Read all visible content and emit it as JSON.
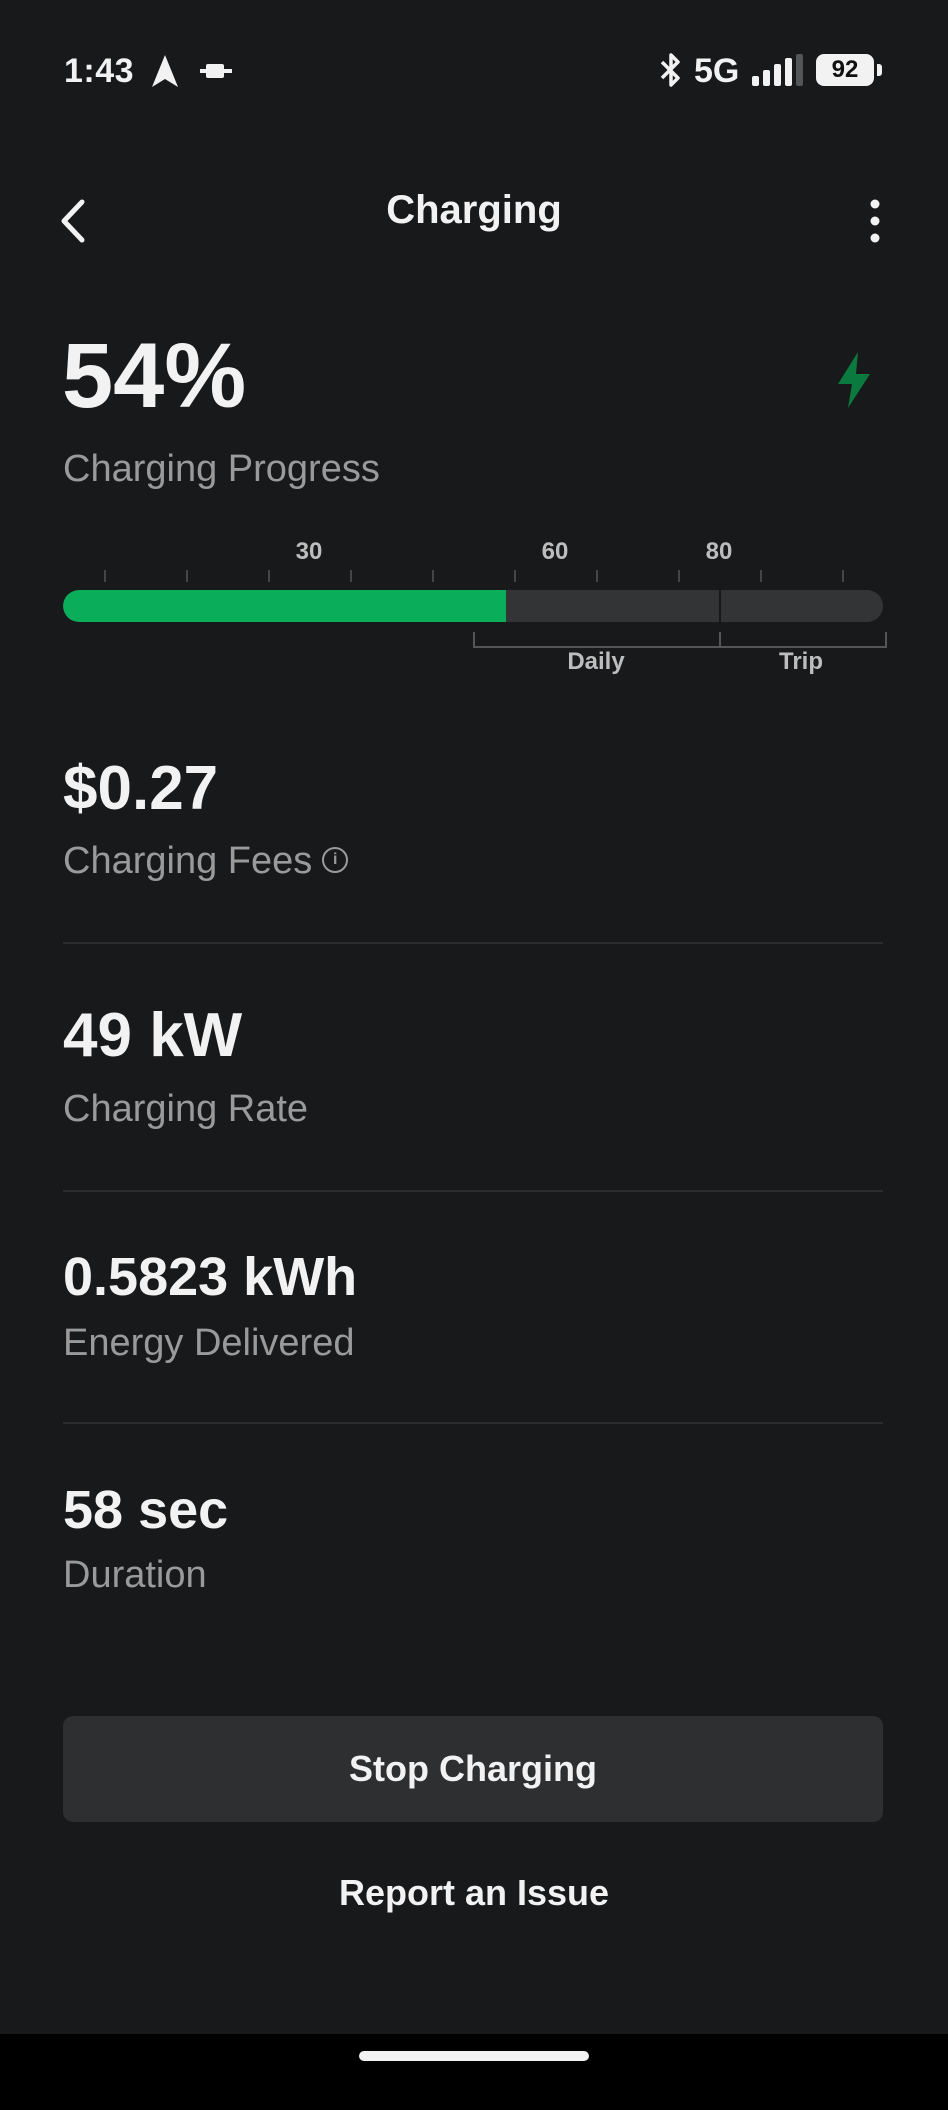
{
  "status_bar": {
    "time": "1:43",
    "network": "5G",
    "battery": "92",
    "icons": [
      "navigation-arrow-icon",
      "cast-icon",
      "bluetooth-icon",
      "signal-icon",
      "battery-icon"
    ]
  },
  "header": {
    "title": "Charging"
  },
  "progress": {
    "value": "54%",
    "label": "Charging Progress",
    "fill_percent": 54,
    "marker_percent": 80,
    "scale_labels": [
      {
        "text": "30",
        "percent": 30
      },
      {
        "text": "60",
        "percent": 60
      },
      {
        "text": "80",
        "percent": 80
      }
    ],
    "range_labels": {
      "daily": "Daily",
      "trip": "Trip"
    },
    "accent_color": "#09ad5a"
  },
  "metrics": {
    "fees": {
      "value": "$0.27",
      "label": "Charging Fees"
    },
    "rate": {
      "value": "49 kW",
      "label": "Charging Rate"
    },
    "energy": {
      "value": "0.5823 kWh",
      "label": "Energy Delivered"
    },
    "duration": {
      "value": "58 sec",
      "label": "Duration"
    }
  },
  "actions": {
    "stop_label": "Stop Charging",
    "report_label": "Report an Issue"
  }
}
